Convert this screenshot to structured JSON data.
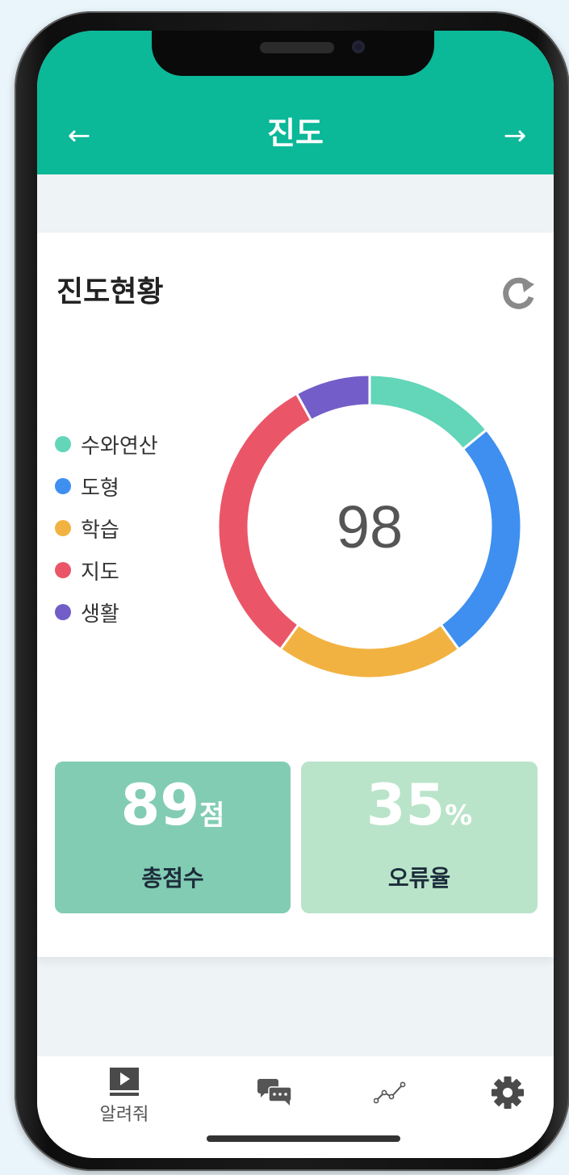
{
  "header": {
    "title": "진도",
    "back_icon": "arrow-left-icon",
    "forward_icon": "arrow-right-icon",
    "color": "#0bb898"
  },
  "card": {
    "title": "진도현황",
    "refresh_icon": "refresh-icon",
    "legend": [
      {
        "label": "수와연산",
        "color": "#63d5b8"
      },
      {
        "label": "도형",
        "color": "#3e8ff0"
      },
      {
        "label": "학습",
        "color": "#f2b241"
      },
      {
        "label": "지도",
        "color": "#ea5668"
      },
      {
        "label": "생활",
        "color": "#735dc8"
      }
    ],
    "center_value": "98"
  },
  "chart_data": {
    "type": "pie",
    "donut": true,
    "categories": [
      "수와연산",
      "도형",
      "학습",
      "지도",
      "생활"
    ],
    "values": [
      14,
      26,
      20,
      32,
      8
    ],
    "colors": [
      "#63d5b8",
      "#3e8ff0",
      "#f2b241",
      "#ea5668",
      "#735dc8"
    ],
    "center_label": "98",
    "legend": "left"
  },
  "stats": [
    {
      "value": "89",
      "unit": "점",
      "label": "총점수",
      "color": "#82ccb4"
    },
    {
      "value": "35",
      "unit": "%",
      "label": "오류율",
      "color": "#b9e4c9"
    }
  ],
  "tabbar": {
    "items": [
      {
        "icon": "play-video-icon",
        "label": "알려줘"
      },
      {
        "icon": "chat-bubbles-icon",
        "label": ""
      },
      {
        "icon": "trend-line-icon",
        "label": ""
      },
      {
        "icon": "gear-icon",
        "label": ""
      }
    ]
  }
}
